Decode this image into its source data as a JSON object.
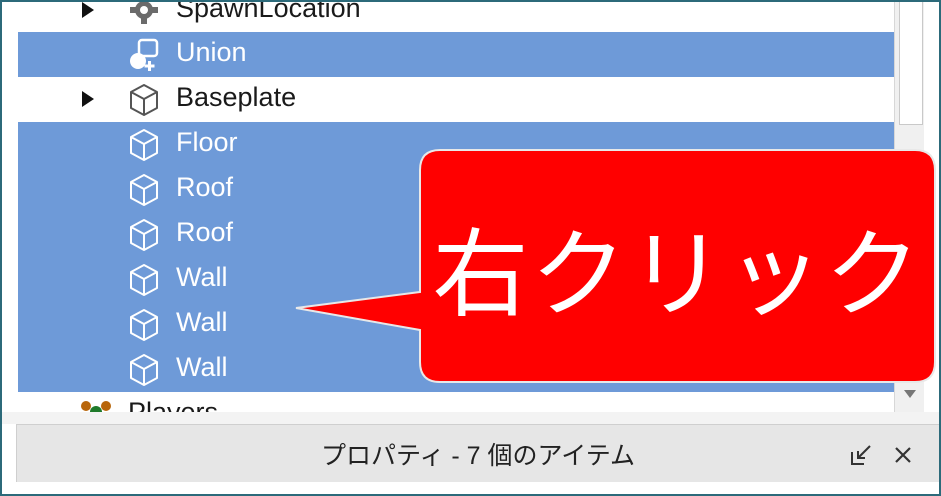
{
  "explorer": {
    "items": [
      {
        "label": "SpawnLocation",
        "icon": "spawn-gear-icon",
        "has_children": true,
        "selected": false
      },
      {
        "label": "Union",
        "icon": "union-icon",
        "has_children": false,
        "selected": true
      },
      {
        "label": "Baseplate",
        "icon": "part-cube-icon",
        "has_children": true,
        "selected": false
      },
      {
        "label": "Floor",
        "icon": "part-cube-icon",
        "has_children": false,
        "selected": true
      },
      {
        "label": "Roof",
        "icon": "part-cube-icon",
        "has_children": false,
        "selected": true
      },
      {
        "label": "Roof",
        "icon": "part-cube-icon",
        "has_children": false,
        "selected": true
      },
      {
        "label": "Wall",
        "icon": "part-cube-icon",
        "has_children": false,
        "selected": true
      },
      {
        "label": "Wall",
        "icon": "part-cube-icon",
        "has_children": false,
        "selected": true
      },
      {
        "label": "Wall",
        "icon": "part-cube-icon",
        "has_children": false,
        "selected": true
      },
      {
        "label": "Players",
        "icon": "players-icon",
        "has_children": false,
        "selected": false
      }
    ]
  },
  "properties_panel": {
    "title": "プロパティ - 7 個のアイテム"
  },
  "callout": {
    "text": "右クリック",
    "color": "#ff0000"
  },
  "colors": {
    "selection": "#6e9ad8",
    "frame_border": "#2c6a7a"
  }
}
